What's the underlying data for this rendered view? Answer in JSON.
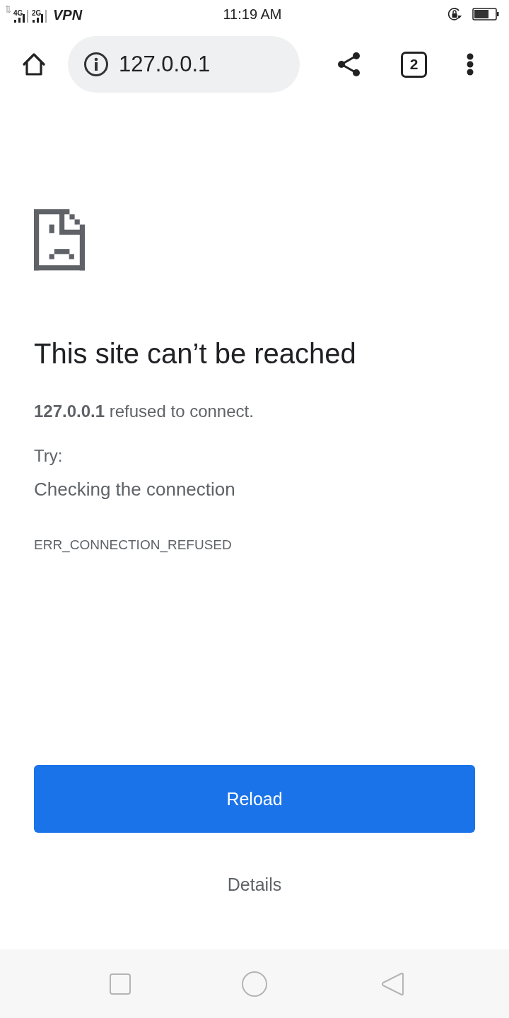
{
  "status_bar": {
    "networks": [
      {
        "label": "4G"
      },
      {
        "label": "2G"
      }
    ],
    "vpn": "VPN",
    "time": "11:19 AM"
  },
  "toolbar": {
    "url": "127.0.0.1",
    "tab_count": "2"
  },
  "error_page": {
    "title": "This site can’t be reached",
    "message": "**127.0.0.1** refused to connect.",
    "try_label": "Try:",
    "suggestions": [
      "Checking the connection"
    ],
    "error_code": "ERR_CONNECTION_REFUSED"
  },
  "actions": {
    "primary": "Reload",
    "secondary": "Details"
  }
}
